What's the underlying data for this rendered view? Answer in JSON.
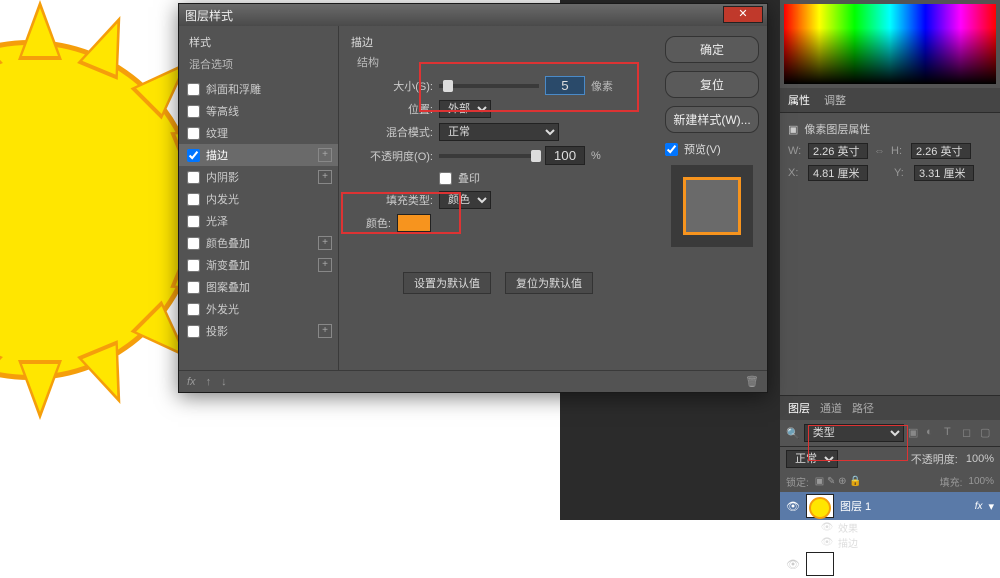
{
  "dialog": {
    "title": "图层样式",
    "styles_header": "样式",
    "blend_options": "混合选项",
    "style_list": [
      {
        "label": "斜面和浮雕",
        "checked": false
      },
      {
        "label": "等高线",
        "checked": false
      },
      {
        "label": "纹理",
        "checked": false
      },
      {
        "label": "描边",
        "checked": true,
        "active": true,
        "plus": true
      },
      {
        "label": "内阴影",
        "checked": false,
        "plus": true
      },
      {
        "label": "内发光",
        "checked": false
      },
      {
        "label": "光泽",
        "checked": false
      },
      {
        "label": "颜色叠加",
        "checked": false,
        "plus": true
      },
      {
        "label": "渐变叠加",
        "checked": false,
        "plus": true
      },
      {
        "label": "图案叠加",
        "checked": false
      },
      {
        "label": "外发光",
        "checked": false
      },
      {
        "label": "投影",
        "checked": false,
        "plus": true
      }
    ],
    "group_title": "描边",
    "struct_title": "结构",
    "size_label": "大小(S):",
    "size_value": "5",
    "size_unit": "像素",
    "position_label": "位置:",
    "position_value": "外部",
    "blend_label": "混合模式:",
    "blend_value": "正常",
    "opacity_label": "不透明度(O):",
    "opacity_value": "100",
    "opacity_unit": "%",
    "overprint_label": "叠印",
    "filltype_label": "填充类型:",
    "filltype_value": "颜色",
    "color_label": "颜色:",
    "color_hex": "#f7941e",
    "set_default": "设置为默认值",
    "reset_default": "复位为默认值",
    "ok": "确定",
    "cancel": "复位",
    "new_style": "新建样式(W)...",
    "preview": "预览(V)",
    "fx_label": "fx"
  },
  "right": {
    "props_tab": "属性",
    "adjust_tab": "调整",
    "pixel_props": "像素图层属性",
    "w_label": "W:",
    "w_value": "2.26 英寸",
    "h_label": "H:",
    "h_value": "2.26 英寸",
    "x_label": "X:",
    "x_value": "4.81 厘米",
    "y_label": "Y:",
    "y_value": "3.31 厘米",
    "layers_tab": "图层",
    "channels_tab": "通道",
    "paths_tab": "路径",
    "filter_type": "类型",
    "blend_mode": "正常",
    "opacity_label_p": "不透明度:",
    "opacity_value_p": "100%",
    "lock_label": "锁定:",
    "fill_label": "填充:",
    "fill_value": "100%",
    "layer1": "图层 1",
    "fx": "fx",
    "effects": "效果",
    "stroke": "描边"
  }
}
